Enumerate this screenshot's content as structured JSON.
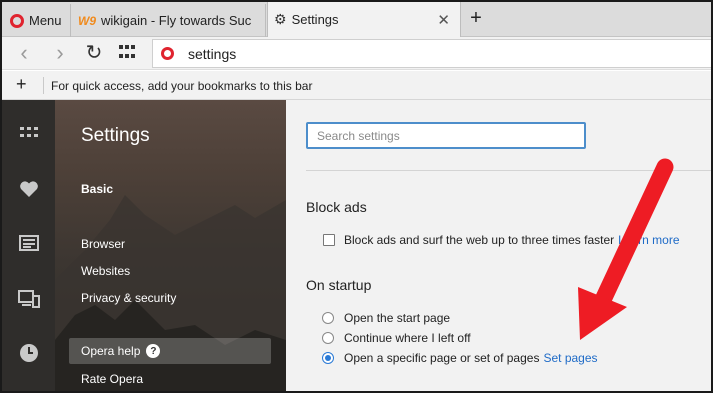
{
  "tabs": {
    "menu_label": "Menu",
    "wiki_label": "wikigain - Fly towards Suc",
    "wiki_icon_text": "W9",
    "settings_label": "Settings"
  },
  "address": {
    "url": "settings"
  },
  "bookmarks": {
    "message": "For quick access, add your bookmarks to this bar"
  },
  "settings_nav": {
    "title": "Settings",
    "basic": "Basic",
    "browser": "Browser",
    "websites": "Websites",
    "privacy": "Privacy & security",
    "help": "Opera help",
    "rate": "Rate Opera"
  },
  "main": {
    "search_placeholder": "Search settings",
    "block_ads": {
      "title": "Block ads",
      "checkbox_label": "Block ads and surf the web up to three times faster",
      "learn_more": "Learn more"
    },
    "startup": {
      "title": "On startup",
      "options": [
        "Open the start page",
        "Continue where I left off",
        "Open a specific page or set of pages"
      ],
      "selected_index": 2,
      "set_pages": "Set pages"
    }
  },
  "colors": {
    "accent": "#2a7ad6",
    "opera_red": "#e0242f",
    "annotation_arrow": "#ee1c24"
  }
}
